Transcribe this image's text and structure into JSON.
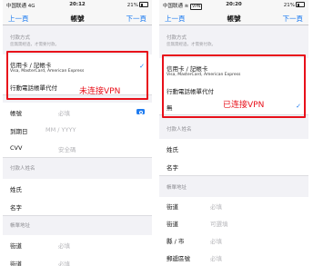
{
  "left": {
    "status": {
      "carrier": "中国联通 4G",
      "time": "20:12",
      "battery": "21%"
    },
    "nav": {
      "back": "上一頁",
      "title": "帳號",
      "next": "下一頁"
    },
    "payment_section": {
      "title": "付款方式",
      "subtitle": "您無需經過，才需要付款。"
    },
    "payment_rows": [
      {
        "label": "信用卡 / 記帳卡",
        "sub": "Visa, MasterCard, American Express"
      },
      {
        "label": "行動電話帳單代付"
      }
    ],
    "annotation": "未连接VPN",
    "card_rows": [
      {
        "label": "帳號",
        "placeholder": "必填"
      },
      {
        "label": "到期日",
        "placeholder": "MM / YYYY"
      },
      {
        "label": "CVV",
        "placeholder": "安全碼"
      }
    ],
    "payer_section": {
      "title": "付款人姓名"
    },
    "payer_rows": [
      {
        "label": "姓氏"
      },
      {
        "label": "名字"
      }
    ],
    "address_section": {
      "title": "帳單地址"
    },
    "address_rows": [
      {
        "label": "街道",
        "placeholder": "必填"
      },
      {
        "label": "街道",
        "placeholder": "必填"
      }
    ]
  },
  "right": {
    "status": {
      "carrier": "中国联通",
      "time": "20:20",
      "battery": "21%"
    },
    "nav": {
      "back": "上一頁",
      "title": "帳號",
      "next": "下一頁"
    },
    "payment_section": {
      "title": "付款方式",
      "subtitle": "您無需經過，才需要付款。"
    },
    "payment_rows": [
      {
        "label": "信用卡 / 記帳卡",
        "sub": "Visa, MasterCard, American Express"
      },
      {
        "label": "行動電話帳單代付"
      },
      {
        "label": "無"
      }
    ],
    "annotation": "已连接VPN",
    "payer_section": {
      "title": "付款人姓名"
    },
    "payer_rows": [
      {
        "label": "姓氏"
      },
      {
        "label": "名字"
      }
    ],
    "address_section": {
      "title": "帳單地址"
    },
    "address_rows": [
      {
        "label": "街道",
        "placeholder": "必填"
      },
      {
        "label": "街道",
        "placeholder": "可選填"
      },
      {
        "label": "縣 / 市",
        "placeholder": "必填"
      },
      {
        "label": "郵遞區號",
        "placeholder": "必填"
      }
    ]
  },
  "colors": {
    "accent": "#1f7cf0",
    "annotation": "#e8101a",
    "background": "#f2f2f6"
  },
  "icons": {
    "selected": "checkmark-icon",
    "scan_card": "camera-icon",
    "battery": "battery-icon"
  }
}
